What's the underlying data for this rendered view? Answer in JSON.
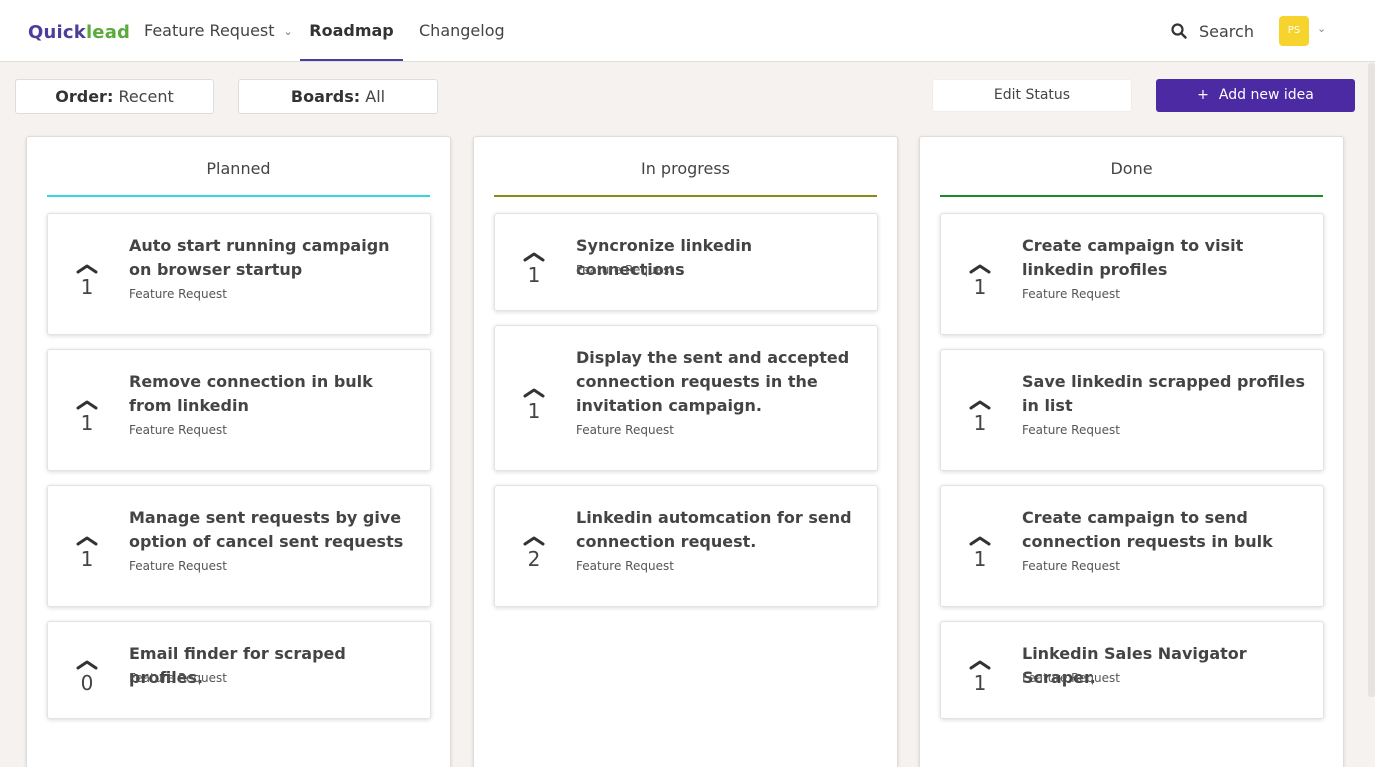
{
  "header": {
    "logo_part1": "Quick",
    "logo_part2": "lead",
    "nav": {
      "feature_request": "Feature Request",
      "roadmap": "Roadmap",
      "changelog": "Changelog"
    },
    "search_label": "Search",
    "avatar_initials": "PS"
  },
  "toolbar": {
    "order_label": "Order:",
    "order_value": "Recent",
    "boards_label": "Boards:",
    "boards_value": "All",
    "edit_status": "Edit Status",
    "add_idea": "Add new idea"
  },
  "colors": {
    "brand": "#4b3f9c",
    "add_button": "#4b2aa3",
    "planned": "#35d6e0",
    "in_progress": "#8a8a10",
    "done": "#1e8a2a"
  },
  "columns": [
    {
      "title": "Planned",
      "cards": [
        {
          "title": "Auto start running campaign on browser startup",
          "tag": "Feature Request",
          "votes": "1"
        },
        {
          "title": "Remove connection in bulk from linkedin",
          "tag": "Feature Request",
          "votes": "1"
        },
        {
          "title": "Manage sent requests by give option of cancel sent requests",
          "tag": "Feature Request",
          "votes": "1"
        },
        {
          "title": "Email finder for scraped profiles.",
          "tag": "Feature Request",
          "votes": "0"
        }
      ]
    },
    {
      "title": "In progress",
      "cards": [
        {
          "title": "Syncronize linkedin connections",
          "tag": "Feature Request",
          "votes": "1"
        },
        {
          "title": "Display the sent and accepted connection requests in the invitation campaign.",
          "tag": "Feature Request",
          "votes": "1"
        },
        {
          "title": "Linkedin automcation for send connection request.",
          "tag": "Feature Request",
          "votes": "2"
        }
      ]
    },
    {
      "title": "Done",
      "cards": [
        {
          "title": "Create campaign to visit linkedin profiles",
          "tag": "Feature Request",
          "votes": "1"
        },
        {
          "title": "Save linkedin scrapped profiles in list",
          "tag": "Feature Request",
          "votes": "1"
        },
        {
          "title": "Create campaign to send connection requests in bulk",
          "tag": "Feature Request",
          "votes": "1"
        },
        {
          "title": "Linkedin Sales Navigator Scraper.",
          "tag": "Feature Request",
          "votes": "1"
        }
      ]
    }
  ]
}
